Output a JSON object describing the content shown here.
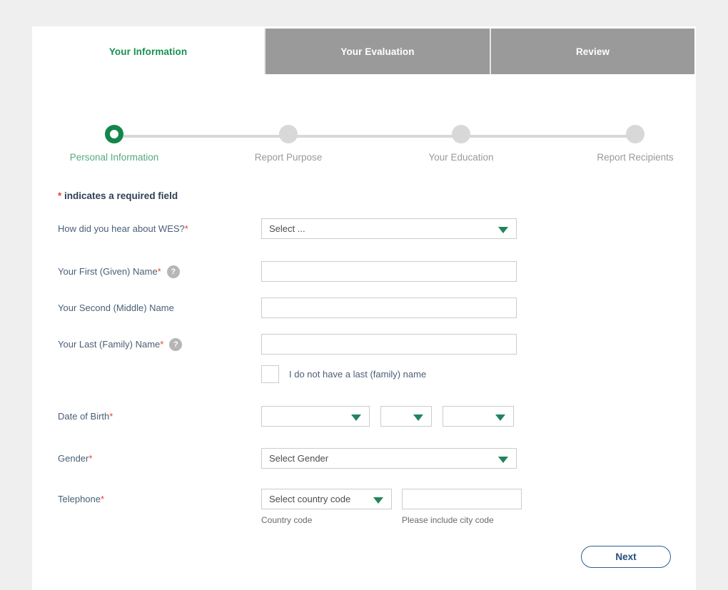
{
  "tabs": [
    {
      "label": "Your Information",
      "active": true
    },
    {
      "label": "Your Evaluation",
      "active": false
    },
    {
      "label": "Review",
      "active": false
    }
  ],
  "stepper": {
    "steps": [
      {
        "label": "Personal Information",
        "state": "current"
      },
      {
        "label": "Report Purpose",
        "state": "pending"
      },
      {
        "label": "Your Education",
        "state": "pending"
      },
      {
        "label": "Report Recipients",
        "state": "pending"
      }
    ]
  },
  "form": {
    "required_note_star": "*",
    "required_note": " indicates a required field",
    "fields": {
      "hear_about": {
        "label": "How did you hear about WES?",
        "star": "*",
        "value": "Select ..."
      },
      "first_name": {
        "label": "Your First (Given) Name",
        "star": "*",
        "help": "?",
        "value": ""
      },
      "middle_name": {
        "label": "Your Second (Middle) Name",
        "star": "",
        "value": ""
      },
      "last_name": {
        "label": "Your Last (Family) Name",
        "star": "*",
        "help": "?",
        "value": ""
      },
      "no_last_name": {
        "checkbox_label": "I do not have a last (family) name",
        "checked": false
      },
      "dob": {
        "label": "Date of Birth",
        "star": "*",
        "month_value": "",
        "day_value": "",
        "year_value": ""
      },
      "gender": {
        "label": "Gender",
        "star": "*",
        "value": "Select Gender"
      },
      "telephone": {
        "label": "Telephone",
        "star": "*",
        "country_code_value": "Select country code",
        "country_code_helper": "Country code",
        "number_value": "",
        "number_helper": "Please include city code"
      }
    }
  },
  "footer": {
    "next_label": "Next"
  },
  "colors": {
    "accent_green": "#12874a",
    "tab_active_text": "#189152",
    "tab_inactive_bg": "#9a9a9a",
    "required_star": "#e8452c",
    "label_text": "#4a5f77",
    "button_blue": "#1f4e79",
    "page_bg": "#efefef"
  }
}
